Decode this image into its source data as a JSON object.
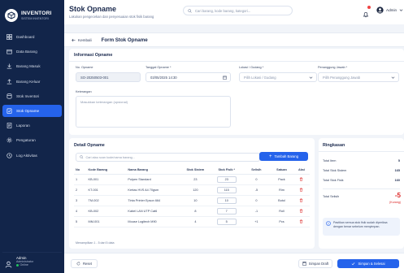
{
  "brand": {
    "name": "INVENTORI",
    "tagline": "SISTEM INVENTORI"
  },
  "sidebar": {
    "items": [
      {
        "label": "Dashboard",
        "icon": "dashboard-icon"
      },
      {
        "label": "Data Barang",
        "icon": "box-icon"
      },
      {
        "label": "Barang Masuk",
        "icon": "download-icon"
      },
      {
        "label": "Barang Keluar",
        "icon": "upload-icon"
      },
      {
        "label": "Stok Inventori",
        "icon": "database-icon"
      },
      {
        "label": "Stok Opname",
        "icon": "clipboard-icon",
        "active": true
      },
      {
        "label": "Laporan",
        "icon": "report-icon"
      },
      {
        "label": "Pengaturan",
        "icon": "gear-icon"
      },
      {
        "label": "Log Aktivitas",
        "icon": "clock-icon"
      }
    ],
    "user": {
      "name": "Admin",
      "role": "Administrator",
      "status": "Online"
    }
  },
  "header": {
    "title": "Stok Opname",
    "subtitle": "Lakukan pengecekan dan penyesuaian stok fisik barang",
    "search_placeholder": "Cari barang, kode barang, kategori...",
    "user_label": "Admin"
  },
  "crumb": {
    "back_label": "Kembali",
    "title": "Form Stok Opname"
  },
  "info": {
    "title": "Informasi Opname",
    "no_label": "No. Opname",
    "no_value": "SO-20250503-001",
    "date_label": "Tanggal Opname *",
    "date_value": "03/05/2025 14:30",
    "lokasi_label": "Lokasi / Gudang *",
    "lokasi_placeholder": "Pilih Lokasi / Gudang",
    "pj_label": "Penanggung Jawab *",
    "pj_placeholder": "Pilih Penanggung Jawab",
    "ket_label": "Keterangan",
    "ket_placeholder": "Masukkan keterangan (opsional)"
  },
  "detail": {
    "title": "Detail Opname",
    "search_placeholder": "Cari atau scan kode/nama barang...",
    "add_label": "Tambah Barang",
    "columns": [
      "No",
      "Kode Barang",
      "Nama Barang",
      "Stok Sistem",
      "Stok Fisik *",
      "Selisih",
      "Satuan",
      "Aksi"
    ],
    "rows": [
      {
        "no": "1",
        "kode": "KB-001",
        "nama": "Pulpen Standard",
        "sistem": "23",
        "fisik": "23",
        "selisih": "0",
        "satuan": "Pack",
        "sign": "zero"
      },
      {
        "no": "2",
        "kode": "KT-001",
        "nama": "Kertas HVS A4 70gsm",
        "sistem": "120",
        "fisik": "115",
        "selisih": "-5",
        "satuan": "Rim",
        "sign": "neg"
      },
      {
        "no": "3",
        "kode": "TM-002",
        "nama": "Tinta Printer Epson 664",
        "sistem": "10",
        "fisik": "10",
        "selisih": "0",
        "satuan": "Botol",
        "sign": "zero"
      },
      {
        "no": "4",
        "kode": "KB-002",
        "nama": "Kabel LAN UTP Cat6",
        "sistem": "8",
        "fisik": "7",
        "selisih": "-1",
        "satuan": "Roll",
        "sign": "neg"
      },
      {
        "no": "5",
        "kode": "MM-001",
        "nama": "Mouse Logitech M90",
        "sistem": "4",
        "fisik": "5",
        "selisih": "+1",
        "satuan": "Pcs",
        "sign": "pos"
      }
    ],
    "footer": "Menampilkan 1 - 5 dari 5 data"
  },
  "summary": {
    "title": "Ringkasan",
    "total_item_label": "Total Item",
    "total_item": "5",
    "total_sistem_label": "Total Stok Sistem",
    "total_sistem": "165",
    "total_fisik_label": "Total Stok Fisik",
    "total_fisik": "160",
    "total_selisih_label": "Total Selisih",
    "total_selisih": "-5",
    "selisih_note": "(Kurang)",
    "note": "Pastikan semua stok fisik sudah diperiksa dengan benar sebelum menyimpan."
  },
  "bottom": {
    "reset_label": "Reset",
    "draft_label": "Simpan Draft",
    "save_label": "Simpan & Selesai"
  },
  "colors": {
    "sidebar": "#12254a",
    "accent": "#2563eb",
    "negative": "#dc2626",
    "positive": "#16a34a"
  }
}
